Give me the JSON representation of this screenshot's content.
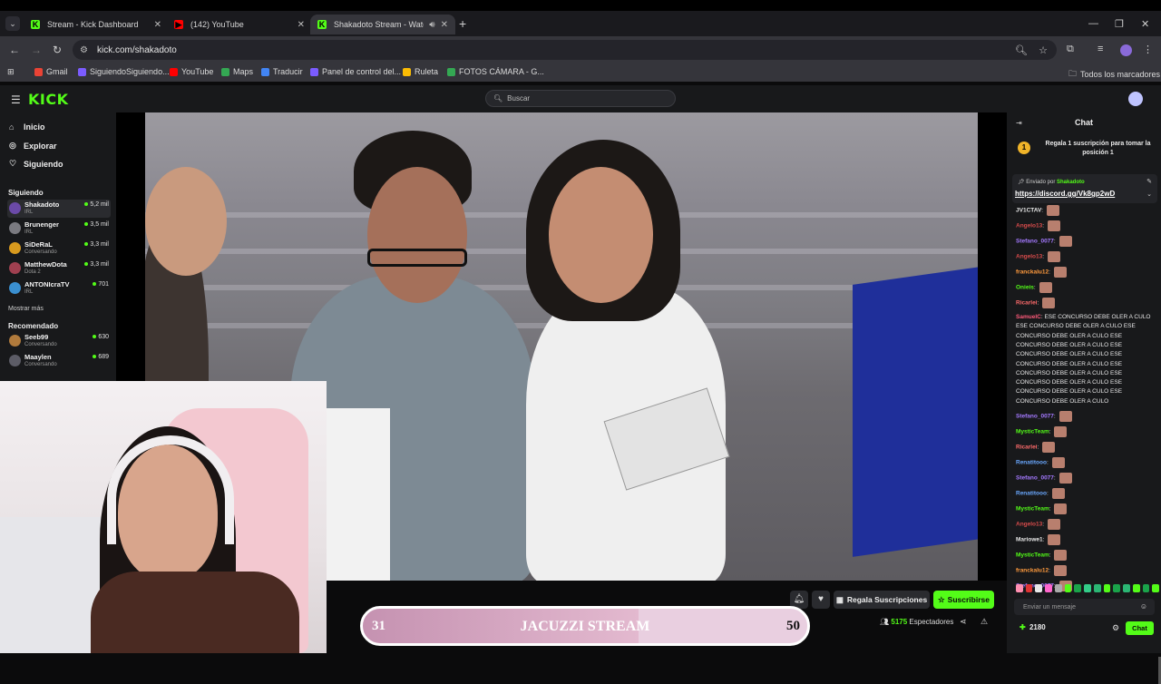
{
  "browser": {
    "tabs": [
      {
        "title": "Stream - Kick Dashboard",
        "favicon_color": "#53fc18",
        "favicon_glyph": "K"
      },
      {
        "title": "(142) YouTube",
        "favicon_color": "#ff0000",
        "favicon_glyph": "▶"
      },
      {
        "title": "Shakadoto Stream - Watch",
        "favicon_color": "#53fc18",
        "favicon_glyph": "K"
      }
    ],
    "url": "kick.com/shakadoto",
    "bookmarks": [
      {
        "label": "Gmail",
        "color": "#ea4335"
      },
      {
        "label": "SiguiendoSiguiendo...",
        "color": "#7b5cff"
      },
      {
        "label": "YouTube",
        "color": "#ff0000"
      },
      {
        "label": "Maps",
        "color": "#34a853"
      },
      {
        "label": "Traducir",
        "color": "#4285f4"
      },
      {
        "label": "Panel de control del...",
        "color": "#7b5cff"
      },
      {
        "label": "Ruleta",
        "color": "#fbbc04"
      },
      {
        "label": "FOTOS CÁMARA - G...",
        "color": "#34a853"
      }
    ],
    "all_bookmarks": "Todos los marcadores"
  },
  "header": {
    "logo": "KICK",
    "search_placeholder": "Buscar"
  },
  "sidebar": {
    "nav": [
      {
        "label": "Inicio",
        "icon": "home-icon"
      },
      {
        "label": "Explorar",
        "icon": "compass-icon"
      },
      {
        "label": "Siguiendo",
        "icon": "heart-icon"
      }
    ],
    "following_title": "Siguiendo",
    "following": [
      {
        "name": "Shakadoto",
        "category": "IRL",
        "viewers": "5,2 mil",
        "color": "#6b4aa8"
      },
      {
        "name": "Brunenger",
        "category": "IRL",
        "viewers": "3,5 mil",
        "color": "#7a7a80"
      },
      {
        "name": "SiDeRaL",
        "category": "Conversando",
        "viewers": "3,3 mil",
        "color": "#d89a1e"
      },
      {
        "name": "MatthewDota",
        "category": "Dota 2",
        "viewers": "3,3 mil",
        "color": "#a04050"
      },
      {
        "name": "ANTONIcraTV",
        "category": "IRL",
        "viewers": "701",
        "color": "#3a8fd0"
      }
    ],
    "show_more": "Mostrar más",
    "recommended_title": "Recomendado",
    "recommended": [
      {
        "name": "Seeb99",
        "category": "Conversando",
        "viewers": "630",
        "color": "#b07a3c"
      },
      {
        "name": "Maaylen",
        "category": "Conversando",
        "viewers": "689",
        "color": "#5c5c66"
      }
    ]
  },
  "player": {
    "progress": {
      "left": "31",
      "title": "JACUZZI STREAM",
      "right": "50",
      "fraction": 0.62
    },
    "gift_button": "Regala Suscripciones",
    "subscribe_button": "Suscribirse",
    "viewers_count": "5175",
    "viewers_label": "Espectadores"
  },
  "chat": {
    "title": "Chat",
    "gift_banner": "Regala 1 suscripción para tomar la posición 1",
    "gift_badge": "1",
    "pinned": {
      "by_label": "Enviado por",
      "by_user": "Shakadoto",
      "link": "https://discord.gg/Vk8gp2wD"
    },
    "messages": [
      {
        "user": "JV1CTAV",
        "color": "#e8e8e8",
        "text": ""
      },
      {
        "user": "Angelo13",
        "color": "#d74b4b",
        "text": ""
      },
      {
        "user": "Stefano_0077",
        "color": "#a479ff",
        "text": ""
      },
      {
        "user": "Angelo13",
        "color": "#d74b4b",
        "text": ""
      },
      {
        "user": "franckalu12",
        "color": "#ff9a3d",
        "text": ""
      },
      {
        "user": "Onieis",
        "color": "#53fc18",
        "text": ""
      },
      {
        "user": "Ricarlei",
        "color": "#ff6b6b",
        "text": ""
      },
      {
        "user": "SamuelC",
        "color": "#ff5a7a",
        "text": "ESE CONCURSO DEBE OLER A CULO ESE CONCURSO DEBE OLER A CULO ESE CONCURSO DEBE OLER A CULO ESE CONCURSO DEBE OLER A CULO ESE CONCURSO DEBE OLER A CULO ESE CONCURSO DEBE OLER A CULO ESE CONCURSO DEBE OLER A CULO ESE CONCURSO DEBE OLER A CULO ESE CONCURSO DEBE OLER A CULO ESE CONCURSO DEBE OLER A CULO"
      },
      {
        "user": "Stefano_0077",
        "color": "#a479ff",
        "text": ""
      },
      {
        "user": "MysticTeam",
        "color": "#53fc18",
        "text": ""
      },
      {
        "user": "Ricarlei",
        "color": "#ff6b6b",
        "text": ""
      },
      {
        "user": "Renatitooo",
        "color": "#6aa8ff",
        "text": ""
      },
      {
        "user": "Stefano_0077",
        "color": "#a479ff",
        "text": ""
      },
      {
        "user": "Renatitooo",
        "color": "#6aa8ff",
        "text": ""
      },
      {
        "user": "MysticTeam",
        "color": "#53fc18",
        "text": ""
      },
      {
        "user": "Angelo13",
        "color": "#d74b4b",
        "text": ""
      },
      {
        "user": "Mariowe1",
        "color": "#e8e8e8",
        "text": ""
      },
      {
        "user": "MysticTeam",
        "color": "#53fc18",
        "text": ""
      },
      {
        "user": "franckalu12",
        "color": "#ff9a3d",
        "text": ""
      },
      {
        "user": "Stefano_0077",
        "color": "#a479ff",
        "text": ""
      }
    ],
    "emote_colors": [
      "#ff8fb1",
      "#d33",
      "#e8e8e8",
      "#f6c",
      "#aaa",
      "#53fc18",
      "#1aa34a",
      "#3c8",
      "#2bb673",
      "#53fc18",
      "#1aa34a",
      "#2bb673",
      "#53fc18",
      "#1aa34a",
      "#53fc18"
    ],
    "input_placeholder": "Enviar un mensaje",
    "points": "2180",
    "send_button": "Chat"
  }
}
